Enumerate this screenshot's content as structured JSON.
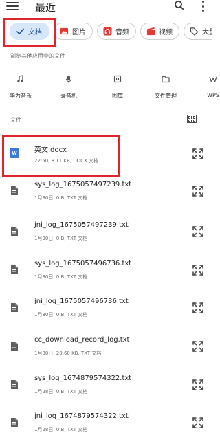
{
  "header": {
    "title": "最近"
  },
  "chips": [
    {
      "label": "文档",
      "icon": "check-icon",
      "selected": true
    },
    {
      "label": "图片",
      "icon": "image-icon",
      "color": "#e53935"
    },
    {
      "label": "音频",
      "icon": "headphones-icon",
      "color": "#e53935"
    },
    {
      "label": "视频",
      "icon": "clapperboard-icon",
      "color": "#e53935"
    },
    {
      "label": "大型",
      "icon": "tag-icon"
    }
  ],
  "apps_section": {
    "label": "浏览其他应用中的文件",
    "items": [
      {
        "label": "华为音乐",
        "icon": "music-note-icon"
      },
      {
        "label": "录音机",
        "icon": "microphone-icon"
      },
      {
        "label": "图库",
        "icon": "gallery-icon"
      },
      {
        "label": "文件管理",
        "icon": "folder-icon"
      },
      {
        "label": "WPS",
        "icon": "wps-icon"
      }
    ]
  },
  "files_section": {
    "label": "文件"
  },
  "files": [
    {
      "name": "英文.docx",
      "meta": "22:50, 8.11 KB, DOCX 文档",
      "type": "word"
    },
    {
      "name": "sys_log_1675057497239.txt",
      "meta": "1月30日, 0 B, TXT 文档",
      "type": "txt"
    },
    {
      "name": "jni_log_1675057497239.txt",
      "meta": "1月30日, 0 B, TXT 文档",
      "type": "txt"
    },
    {
      "name": "sys_log_1675057496736.txt",
      "meta": "1月30日, 0 B, TXT 文档",
      "type": "txt"
    },
    {
      "name": "jni_log_1675057496736.txt",
      "meta": "1月30日, 0 B, TXT 文档",
      "type": "txt"
    },
    {
      "name": "cc_download_record_log.txt",
      "meta": "1月30日, 20.60 KB, TXT 文档",
      "type": "txt"
    },
    {
      "name": "sys_log_1674879574322.txt",
      "meta": "1月28日, 0 B, TXT 文档",
      "type": "txt"
    },
    {
      "name": "jni_log_1674879574322.txt",
      "meta": "1月28日, 0 B, TXT 文档",
      "type": "txt"
    }
  ],
  "colors": {
    "accent": "#1a73e8",
    "selected_chip": "#d6e6fb",
    "highlight": "#e0252f",
    "word_blue": "#3d7bd9"
  }
}
